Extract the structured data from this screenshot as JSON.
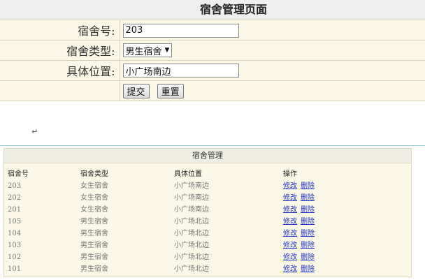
{
  "form": {
    "title": "宿舍管理页面",
    "fields": {
      "room_no": {
        "label": "宿舍号:",
        "value": "203"
      },
      "room_type": {
        "label": "宿舍类型:",
        "selected": "男生宿舍"
      },
      "location": {
        "label": "具体位置:",
        "value": "小广场南边"
      }
    },
    "buttons": {
      "submit": "提交",
      "reset": "重置"
    }
  },
  "para_mark": "↵",
  "list": {
    "title": "宿舍管理",
    "columns": [
      "宿舍号",
      "宿舍类型",
      "具体位置",
      "操作"
    ],
    "action_edit": "修改",
    "action_delete": "删除",
    "rows": [
      {
        "room_no": "203",
        "type": "女生宿舍",
        "location": "小广场南边"
      },
      {
        "room_no": "202",
        "type": "女生宿舍",
        "location": "小广场南边"
      },
      {
        "room_no": "201",
        "type": "女生宿舍",
        "location": "小广场南边"
      },
      {
        "room_no": "105",
        "type": "男生宿舍",
        "location": "小广场北边"
      },
      {
        "room_no": "104",
        "type": "男生宿舍",
        "location": "小广场北边"
      },
      {
        "room_no": "103",
        "type": "男生宿舍",
        "location": "小广场北边"
      },
      {
        "room_no": "102",
        "type": "男生宿舍",
        "location": "小广场北边"
      },
      {
        "room_no": "101",
        "type": "男生宿舍",
        "location": "小广场北边"
      }
    ]
  }
}
